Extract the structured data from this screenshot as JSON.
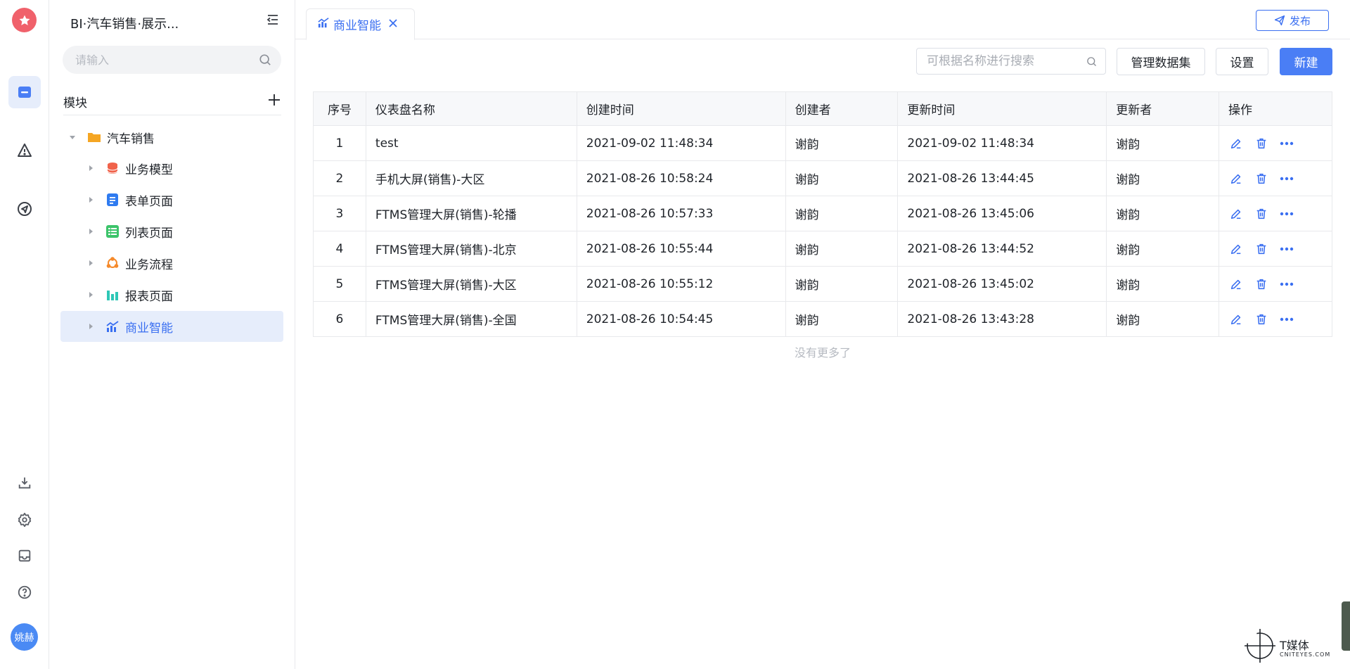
{
  "rail": {
    "avatar_text": "姚赫",
    "icons": [
      "star-logo",
      "folder-icon",
      "alert-icon",
      "send-icon",
      "download-icon",
      "settings-icon",
      "inbox-icon",
      "help-icon"
    ]
  },
  "sidebar": {
    "app_title": "BI·汽车销售·展示...",
    "search_placeholder": "请输入",
    "module_label": "模块",
    "root": {
      "label": "汽车销售",
      "icon": "folder-icon",
      "color": "#f5a623"
    },
    "items": [
      {
        "label": "业务模型",
        "icon": "database-icon",
        "color": "#f0624a"
      },
      {
        "label": "表单页面",
        "icon": "form-icon",
        "color": "#2f7bf0"
      },
      {
        "label": "列表页面",
        "icon": "list-icon",
        "color": "#3cc46a"
      },
      {
        "label": "业务流程",
        "icon": "flow-icon",
        "color": "#f58a2b"
      },
      {
        "label": "报表页面",
        "icon": "report-icon",
        "color": "#2ec7b6"
      },
      {
        "label": "商业智能",
        "icon": "bi-chart-icon",
        "color": "#3a6ff1"
      }
    ]
  },
  "tabs": [
    {
      "label": "商业智能",
      "active": true
    }
  ],
  "publish_label": "发布",
  "toolbar": {
    "search_placeholder": "可根据名称进行搜索",
    "manage_label": "管理数据集",
    "settings_label": "设置",
    "new_label": "新建"
  },
  "table": {
    "headers": [
      "序号",
      "仪表盘名称",
      "创建时间",
      "创建者",
      "更新时间",
      "更新者",
      "操作"
    ],
    "rows": [
      [
        "1",
        "test",
        "2021-09-02 11:48:34",
        "谢韵",
        "2021-09-02 11:48:34",
        "谢韵"
      ],
      [
        "2",
        "手机大屏(销售)-大区",
        "2021-08-26 10:58:24",
        "谢韵",
        "2021-08-26 13:44:45",
        "谢韵"
      ],
      [
        "3",
        "FTMS管理大屏(销售)-轮播",
        "2021-08-26 10:57:33",
        "谢韵",
        "2021-08-26 13:45:06",
        "谢韵"
      ],
      [
        "4",
        "FTMS管理大屏(销售)-北京",
        "2021-08-26 10:55:44",
        "谢韵",
        "2021-08-26 13:44:52",
        "谢韵"
      ],
      [
        "5",
        "FTMS管理大屏(销售)-大区",
        "2021-08-26 10:55:12",
        "谢韵",
        "2021-08-26 13:45:02",
        "谢韵"
      ],
      [
        "6",
        "FTMS管理大屏(销售)-全国",
        "2021-08-26 10:54:45",
        "谢韵",
        "2021-08-26 13:43:28",
        "谢韵"
      ]
    ],
    "footer": "没有更多了"
  },
  "watermark": {
    "title": "T媒体",
    "sub": "CNITEYES.COM"
  },
  "colors": {
    "accent": "#3a6ff1",
    "primary_button": "#4a7ef5",
    "logo": "#f0616b"
  }
}
